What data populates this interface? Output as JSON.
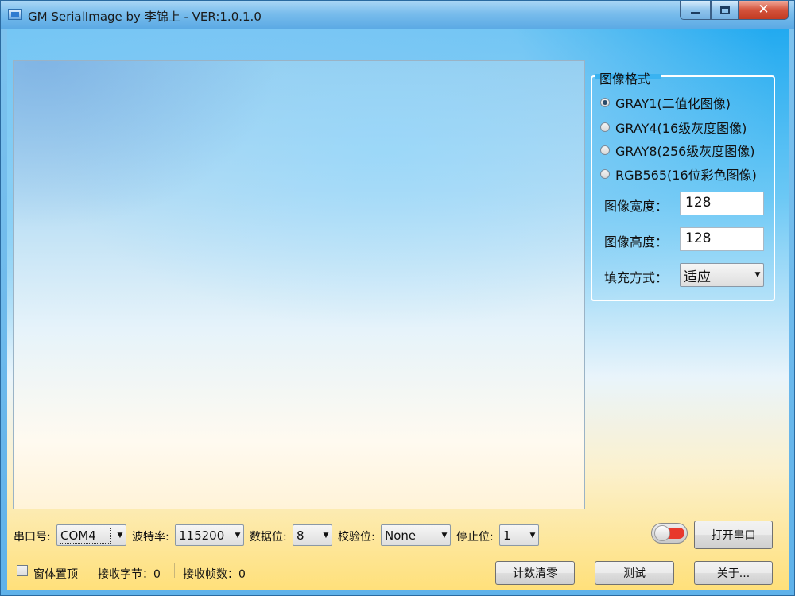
{
  "window": {
    "title": "GM SerialImage by 李锦上 - VER:1.0.1.0"
  },
  "format_group": {
    "title": "图像格式",
    "options": [
      {
        "label": "GRAY1(二值化图像)",
        "checked": true
      },
      {
        "label": "GRAY4(16级灰度图像)",
        "checked": false
      },
      {
        "label": "GRAY8(256级灰度图像)",
        "checked": false
      },
      {
        "label": "RGB565(16位彩色图像)",
        "checked": false
      }
    ],
    "width_label": "图像宽度：",
    "width_value": "128",
    "height_label": "图像高度：",
    "height_value": "128",
    "fill_label": "填充方式：",
    "fill_value": "适应"
  },
  "serial": {
    "port_label": "串口号:",
    "port_value": "COM4",
    "baud_label": "波特率:",
    "baud_value": "115200",
    "databits_label": "数据位:",
    "databits_value": "8",
    "parity_label": "校验位:",
    "parity_value": "None",
    "stopbits_label": "停止位:",
    "stopbits_value": "1",
    "open_button": "打开串口"
  },
  "status": {
    "topmost_label": "窗体置顶",
    "bytes_label": "接收字节：0",
    "frames_label": "接收帧数：0"
  },
  "buttons": {
    "clear_count": "计数清零",
    "test": "测试",
    "about": "关于..."
  },
  "colors": {
    "toggle_off": "#e8392c",
    "close_button": "#c23b22"
  }
}
